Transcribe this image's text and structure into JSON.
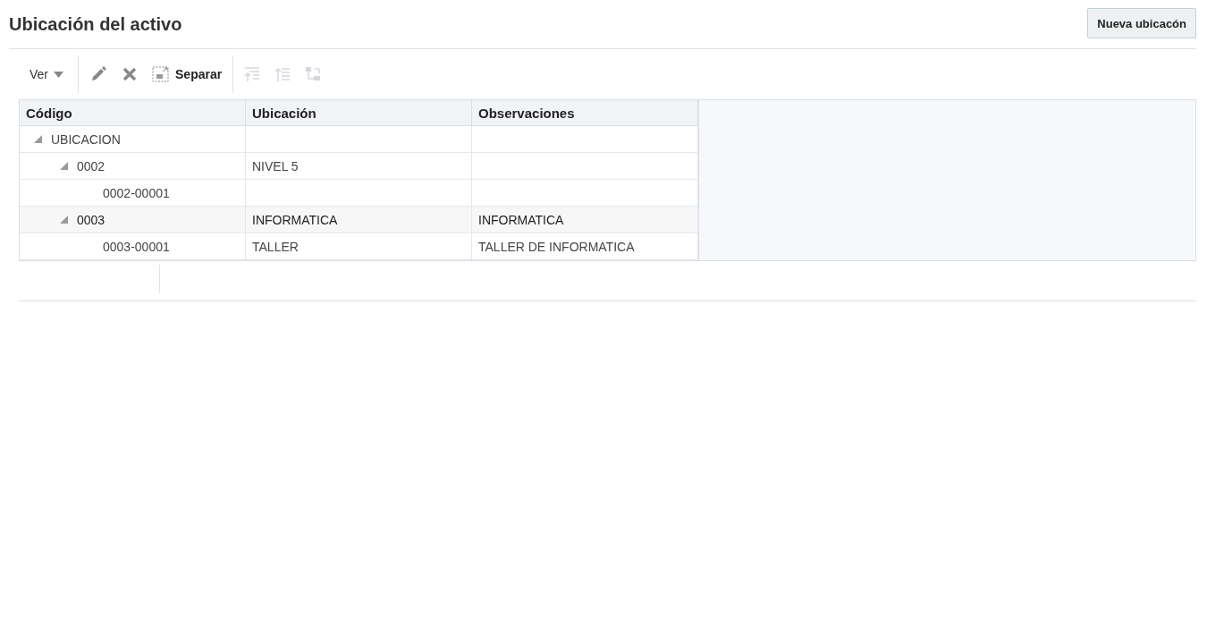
{
  "page": {
    "title": "Ubicación del activo",
    "new_button": "Nueva ubicacón"
  },
  "toolbar": {
    "view_menu": "Ver",
    "tools": [
      {
        "kind": "edit",
        "disabled": false
      },
      {
        "kind": "delete",
        "disabled": false
      },
      {
        "kind": "detach",
        "label": "Separar",
        "disabled": false
      },
      {
        "kind": "expand",
        "disabled": true
      },
      {
        "kind": "collapse",
        "disabled": true
      },
      {
        "kind": "hierarchy",
        "disabled": true
      }
    ]
  },
  "table": {
    "columns": [
      "Código",
      "Ubicación",
      "Observaciones"
    ],
    "rows": [
      {
        "code": "UBICACION",
        "expanded": true,
        "selected": false,
        "children": [
          {
            "code": "0002",
            "location": "NIVEL 5",
            "expanded": true,
            "selected": false,
            "children": [
              {
                "code": "0002-00001",
                "selected": false
              }
            ]
          },
          {
            "code": "0003",
            "location": "INFORMATICA",
            "notes": "INFORMATICA",
            "expanded": true,
            "selected": true,
            "children": [
              {
                "code": "0003-00001",
                "location": "TALLER",
                "notes": "TALLER DE INFORMATICA",
                "selected": false
              }
            ]
          }
        ]
      }
    ]
  }
}
